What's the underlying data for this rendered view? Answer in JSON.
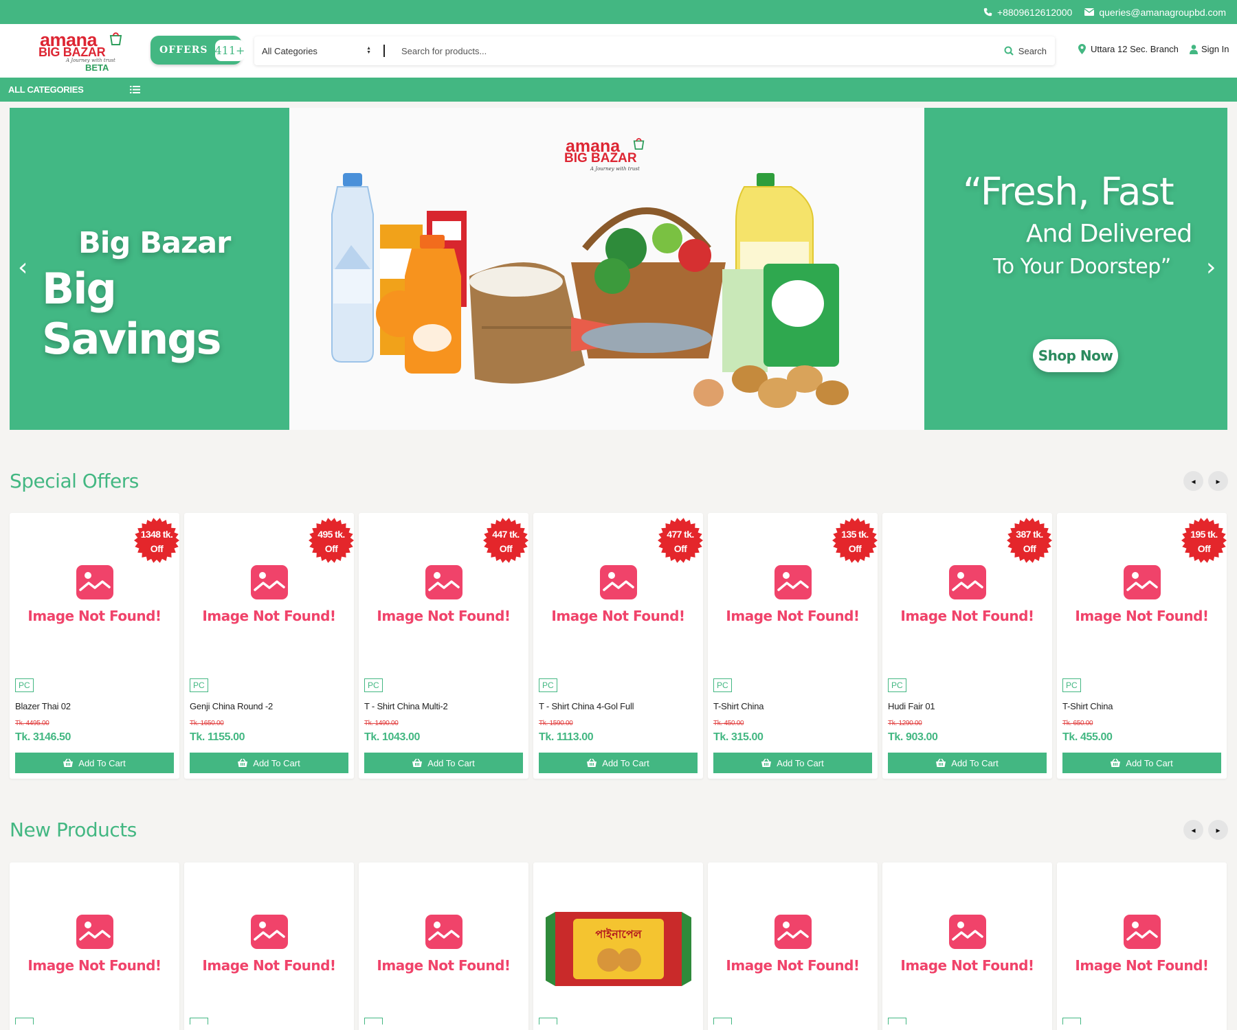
{
  "topbar": {
    "phone": "+8809612612000",
    "email": "queries@amanagroupbd.com"
  },
  "header": {
    "logo": {
      "line1": "amana",
      "line2": "BIG BAZAR",
      "tagline": "A Journey with trust",
      "beta": "BETA"
    },
    "offers_label": "OFFERS",
    "offers_count": "411+",
    "category_select": "All Categories",
    "search_placeholder": "Search for products...",
    "search_button": "Search",
    "branch": "Uttara 12 Sec. Branch",
    "signin": "Sign In"
  },
  "nav": {
    "all_categories": "ALL CATEGORIES"
  },
  "hero": {
    "left_line1": "Big Bazar",
    "left_line2": "Big Savings",
    "center_logo": {
      "line1": "amana",
      "line2": "BIG BAZAR",
      "tagline": "A Journey with trust"
    },
    "right_line1": "“Fresh, Fast",
    "right_line2": "And Delivered",
    "right_line3": "To Your Doorstep”",
    "cta": "Shop Now"
  },
  "placeholder_text": "Image Not Found!",
  "special_offers": {
    "title": "Special Offers",
    "add_to_cart": "Add To Cart",
    "items": [
      {
        "badge_amount": "1348 tk.",
        "badge_off": "Off",
        "unit": "PC",
        "name": "Blazer Thai 02",
        "old_price": "Tk. 4495.00",
        "price": "Tk. 3146.50"
      },
      {
        "badge_amount": "495 tk.",
        "badge_off": "Off",
        "unit": "PC",
        "name": "Genji China Round -2",
        "old_price": "Tk. 1650.00",
        "price": "Tk. 1155.00"
      },
      {
        "badge_amount": "447 tk.",
        "badge_off": "Off",
        "unit": "PC",
        "name": "T - Shirt China Multi-2",
        "old_price": "Tk. 1490.00",
        "price": "Tk. 1043.00"
      },
      {
        "badge_amount": "477 tk.",
        "badge_off": "Off",
        "unit": "PC",
        "name": "T - Shirt China 4-Gol Full",
        "old_price": "Tk. 1590.00",
        "price": "Tk. 1113.00"
      },
      {
        "badge_amount": "135 tk.",
        "badge_off": "Off",
        "unit": "PC",
        "name": "T-Shirt China",
        "old_price": "Tk. 450.00",
        "price": "Tk. 315.00"
      },
      {
        "badge_amount": "387 tk.",
        "badge_off": "Off",
        "unit": "PC",
        "name": "Hudi Fair 01",
        "old_price": "Tk. 1290.00",
        "price": "Tk. 903.00"
      },
      {
        "badge_amount": "195 tk.",
        "badge_off": "Off",
        "unit": "PC",
        "name": "T-Shirt China",
        "old_price": "Tk. 650.00",
        "price": "Tk. 455.00"
      }
    ]
  },
  "new_products": {
    "title": "New Products",
    "product_label": "পাইনাপেল"
  }
}
